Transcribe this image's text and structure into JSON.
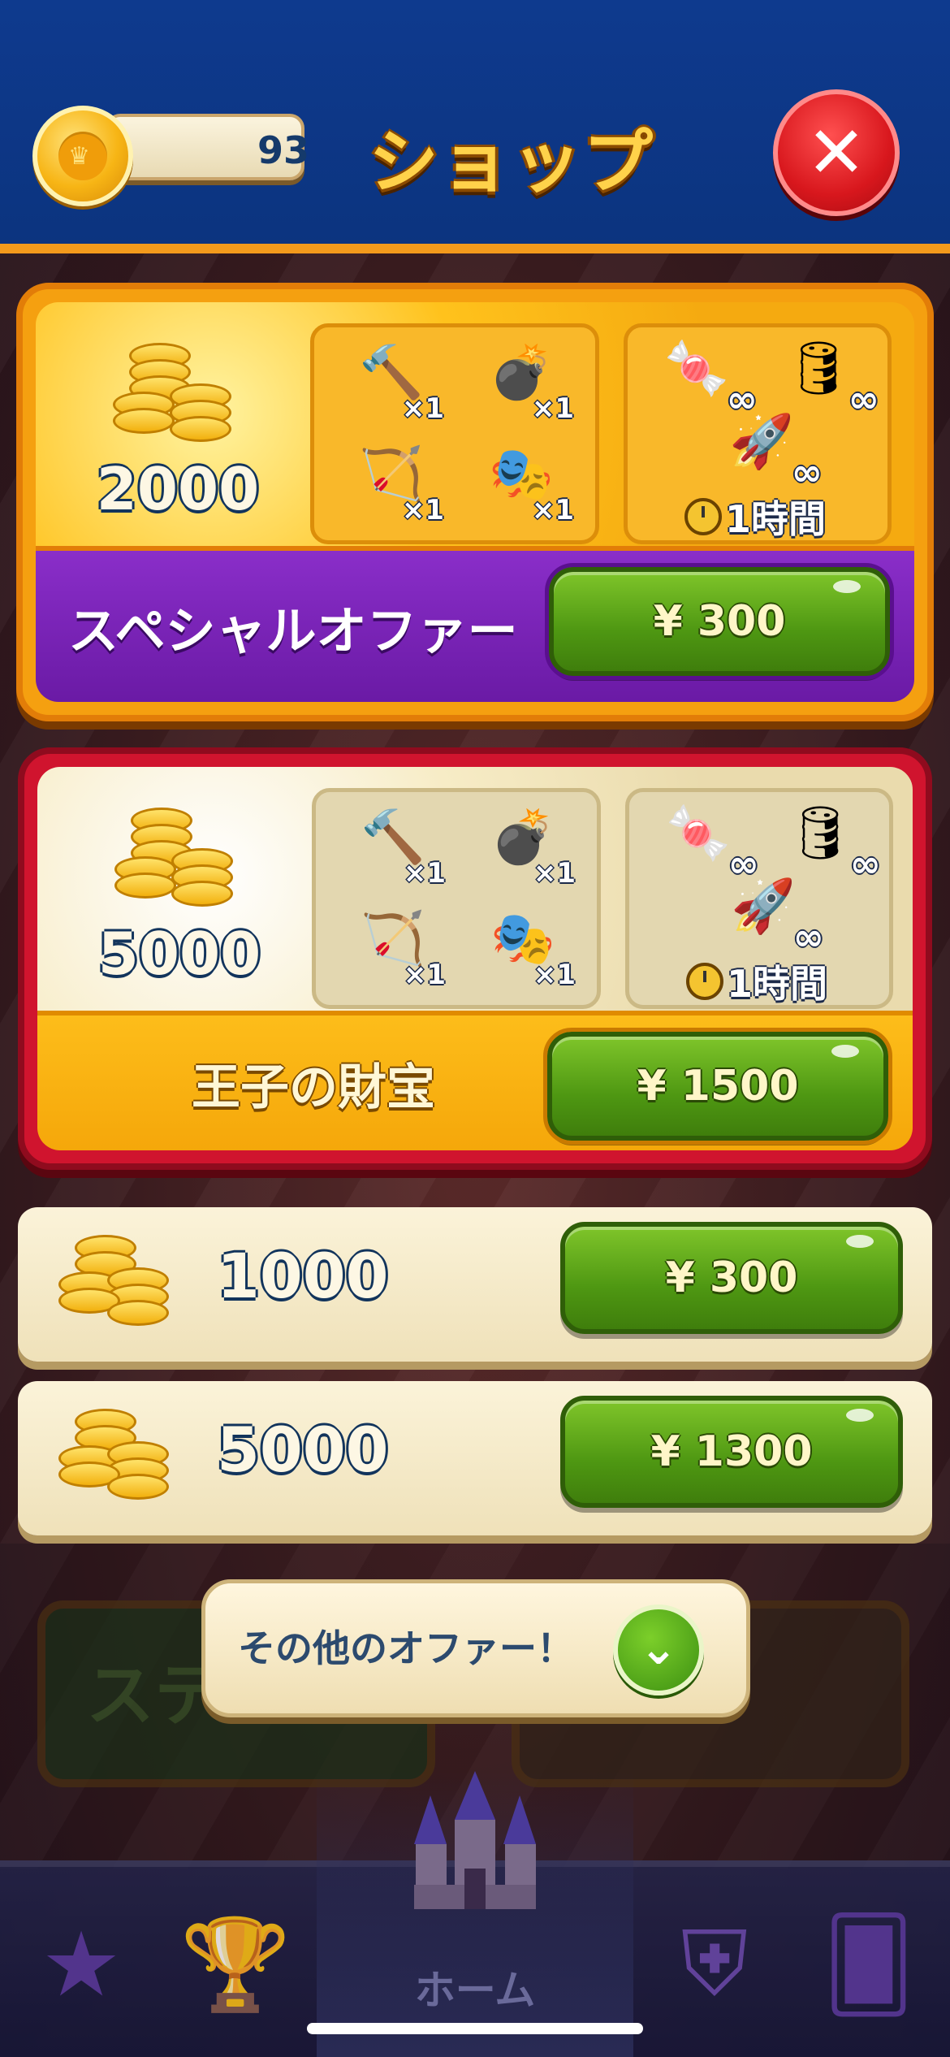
{
  "header": {
    "coin_count": "93",
    "title": "ショップ",
    "close_icon": "close-icon"
  },
  "offers": [
    {
      "id": "special",
      "name": "スペシャルオファー",
      "coins": "2000",
      "boosters": [
        {
          "icon": "hammer-icon",
          "qty": "×1"
        },
        {
          "icon": "cannon-icon",
          "qty": "×1"
        },
        {
          "icon": "bow-icon",
          "qty": "×1"
        },
        {
          "icon": "jester-hat-icon",
          "qty": "×1"
        }
      ],
      "unlimited": [
        {
          "icon": "candy-bomb-icon",
          "qty": "∞"
        },
        {
          "icon": "tnt-barrel-icon",
          "qty": "∞"
        },
        {
          "icon": "rocket-icon",
          "qty": "∞"
        }
      ],
      "duration": "1時間",
      "price": "¥ 300"
    },
    {
      "id": "prince",
      "name": "王子の財宝",
      "coins": "5000",
      "boosters": [
        {
          "icon": "hammer-icon",
          "qty": "×1"
        },
        {
          "icon": "cannon-icon",
          "qty": "×1"
        },
        {
          "icon": "bow-icon",
          "qty": "×1"
        },
        {
          "icon": "jester-hat-icon",
          "qty": "×1"
        }
      ],
      "unlimited": [
        {
          "icon": "candy-bomb-icon",
          "qty": "∞"
        },
        {
          "icon": "tnt-barrel-icon",
          "qty": "∞"
        },
        {
          "icon": "rocket-icon",
          "qty": "∞"
        }
      ],
      "duration": "1時間",
      "price": "¥ 1500"
    }
  ],
  "packs": [
    {
      "coins": "1000",
      "price": "¥ 300"
    },
    {
      "coins": "5000",
      "price": "¥ 1300"
    }
  ],
  "background": {
    "left_button_text": "ステ"
  },
  "more_offers": {
    "label": "その他のオファー！",
    "icon": "chevron-down-icon"
  },
  "bottom_nav": {
    "home_label": "ホーム",
    "items": [
      "star-book-icon",
      "trophy-icon",
      "castle-icon",
      "team-shield-icon",
      "cards-icon"
    ]
  },
  "colors": {
    "header_blue": "#0e3a8e",
    "accent_orange": "#f39a1c",
    "special_purple": "#7a24b8",
    "prince_red": "#d0142e",
    "price_green": "#4e9712"
  }
}
